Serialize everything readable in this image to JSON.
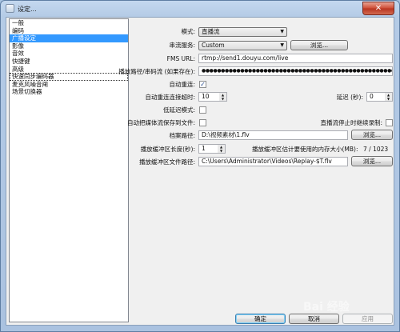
{
  "window": {
    "title": "设定...",
    "close_glyph": "✕"
  },
  "sidebar": {
    "items": [
      {
        "label": "一般"
      },
      {
        "label": "编码"
      },
      {
        "label": "广播设定"
      },
      {
        "label": "影像"
      },
      {
        "label": "音效"
      },
      {
        "label": "快捷键"
      },
      {
        "label": "高级"
      },
      {
        "label": "快速同步编码器"
      },
      {
        "label": "麦克风噪音闸"
      },
      {
        "label": "场景切换器"
      }
    ],
    "selected_index": 2,
    "focused_index": 7
  },
  "form": {
    "mode_label": "模式:",
    "mode_value": "直播流",
    "service_label": "串流服务:",
    "service_value": "Custom",
    "browse_label": "浏览...",
    "fms_label": "FMS URL:",
    "fms_value": "rtmp://send1.douyu.com/live",
    "key_label": "播放路径/串码流 (如果存在):",
    "key_value": "●●●●●●●●●●●●●●●●●●●●●●●●●●●●●●●●●●●●●●●●●●●●●●●●●●●●●●●●●●●●●●●",
    "auto_reconnect_label": "自动重连:",
    "reconnect_timeout_label": "自动重连连接超时:",
    "reconnect_timeout_value": "10",
    "delay_label": "延迟 (秒):",
    "delay_value": "0",
    "low_latency_label": "低延迟模式:",
    "auto_save_label": "自动把媒体流保存到文件:",
    "keep_recording_label": "直播流停止时继续录制:",
    "file_path_label": "档案路径:",
    "file_path_value": "D:\\视频素材\\1.flv",
    "buffer_len_label": "播放缓冲区长度(秒):",
    "buffer_len_value": "1",
    "buffer_mem_label": "播放缓冲区估计要使用的内存大小(MB):",
    "buffer_mem_value": "7 / 1023",
    "buffer_path_label": "播放缓冲区文件路径:",
    "buffer_path_value": "C:\\Users\\Administrator\\Videos\\Replay-$T.flv"
  },
  "footer": {
    "ok": "确定",
    "cancel": "取消",
    "apply": "应用"
  },
  "watermark": "Bai 经验"
}
